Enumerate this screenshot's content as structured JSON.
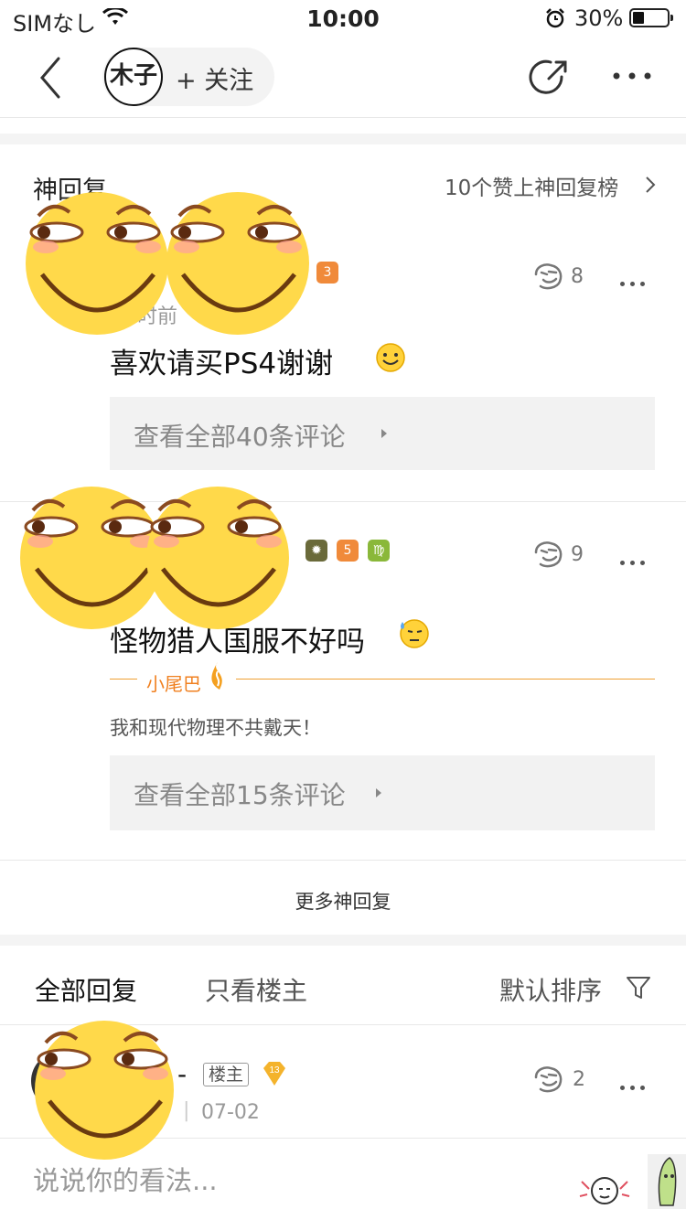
{
  "status_bar": {
    "carrier": "SIMなし",
    "time": "10:00",
    "battery": "30%",
    "battery_level": 0.3
  },
  "nav": {
    "avatar_text": "木子",
    "follow_label": "+ 关注"
  },
  "god_reply": {
    "title": "神回复",
    "link": "10个赞上神回复榜"
  },
  "reply1": {
    "time": "时前",
    "likes": "8",
    "content": "喜欢请买PS4谢谢",
    "view_all": "查看全部40条评论",
    "badge": "3"
  },
  "reply2": {
    "likes": "9",
    "content": "怪物猎人国服不好吗",
    "tail_label": "小尾巴",
    "tail_text": "我和现代物理不共戴天！",
    "view_all": "查看全部15条评论",
    "badge": "5",
    "zodiac": "♍"
  },
  "more_god": "更多神回复",
  "tabs": {
    "all": "全部回复",
    "owner_only": "只看楼主",
    "sort": "默认排序"
  },
  "reply3": {
    "name_suffix": "-",
    "owner_tag": "楼主",
    "level": "13",
    "date": "07-02",
    "likes": "2"
  },
  "input": {
    "placeholder": "说说你的看法..."
  },
  "colors": {
    "accent": "#f08020",
    "emoji_yellow": "#ffd94a",
    "divider": "#f4f4f4"
  }
}
